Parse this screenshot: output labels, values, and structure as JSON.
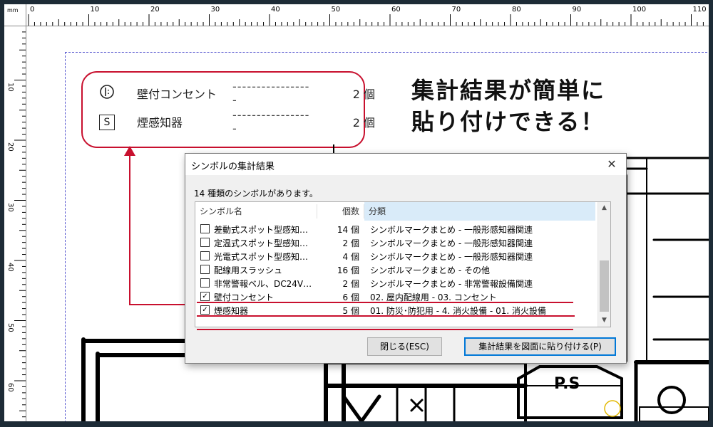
{
  "ruler": {
    "unit": "mm",
    "top_labels": [
      "0",
      "10",
      "20",
      "30",
      "40",
      "50",
      "60",
      "70",
      "80",
      "90",
      "100",
      "110"
    ],
    "left_labels": [
      "10",
      "20",
      "30",
      "40",
      "50",
      "60"
    ]
  },
  "legend": {
    "items": [
      {
        "symbol": "outlet-icon",
        "name": "壁付コンセント",
        "dots": "-----------------",
        "count": "2 個"
      },
      {
        "symbol": "S",
        "name": "煙感知器",
        "dots": "-----------------",
        "count": "2 個"
      }
    ]
  },
  "headline": {
    "line1": "集計結果が簡単に",
    "line2": "貼り付けできる！"
  },
  "plan": {
    "ps_label": "P.S"
  },
  "dialog": {
    "title": "シンボルの集計結果",
    "close_glyph": "✕",
    "info": "14 種類のシンボルがあります。",
    "columns": {
      "name": "シンボル名",
      "count": "個数",
      "category": "分類"
    },
    "rows": [
      {
        "checked": false,
        "name": "差動式スポット型感知…",
        "count": "14 個",
        "category": "シンボルマークまとめ - 一般形感知器関連"
      },
      {
        "checked": false,
        "name": "定温式スポット型感知…",
        "count": "2 個",
        "category": "シンボルマークまとめ - 一般形感知器関連"
      },
      {
        "checked": false,
        "name": "光電式スポット型感知…",
        "count": "4 個",
        "category": "シンボルマークまとめ - 一般形感知器関連"
      },
      {
        "checked": false,
        "name": "配線用スラッシュ",
        "count": "16 個",
        "category": "シンボルマークまとめ - その他"
      },
      {
        "checked": false,
        "name": "非常警報ベル、DC24V…",
        "count": "2 個",
        "category": "シンボルマークまとめ - 非常警報設備関連"
      },
      {
        "checked": true,
        "name": "壁付コンセント",
        "count": "6 個",
        "category": "02. 屋内配線用 - 03. コンセント"
      },
      {
        "checked": true,
        "name": "煙感知器",
        "count": "5 個",
        "category": "01. 防災･防犯用 - 4. 消火設備 - 01. 消火設備"
      }
    ],
    "buttons": {
      "close": "閉じる(ESC)",
      "paste": "集計結果を図面に貼り付ける(P)"
    }
  },
  "colors": {
    "accent_red": "#c8102e",
    "selection_blue": "#0078d7",
    "header_highlight": "#d9ebf9"
  }
}
